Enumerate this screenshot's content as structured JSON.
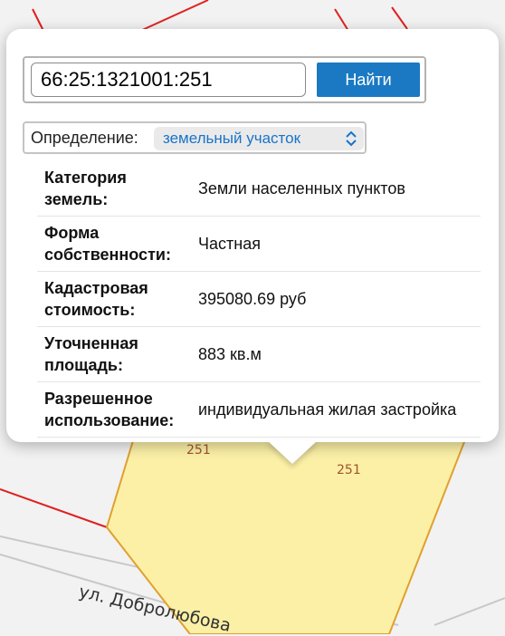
{
  "search": {
    "value": "66:25:1321001:251",
    "button_label": "Найти"
  },
  "definition": {
    "label": "Определение:",
    "selected": "земельный участок"
  },
  "properties": [
    {
      "key": "Категория земель:",
      "value": "Земли населенных пунктов"
    },
    {
      "key": "Форма собственности:",
      "value": "Частная"
    },
    {
      "key": "Кадастровая стоимость:",
      "value": "395080.69 руб"
    },
    {
      "key": "Уточненная площадь:",
      "value": "883 кв.м"
    },
    {
      "key": "Разрешенное использование:",
      "value": "индивидуальная жилая застройка"
    }
  ],
  "map": {
    "parcel_labels": [
      "251",
      "251"
    ],
    "street": "ул. Добролюбова"
  },
  "colors": {
    "button": "#1a79c2",
    "select_text": "#1a73c9",
    "parcel_fill": "#fbf0a6",
    "parcel_border": "#e0a030",
    "cadastral_lines": "#e02020"
  }
}
